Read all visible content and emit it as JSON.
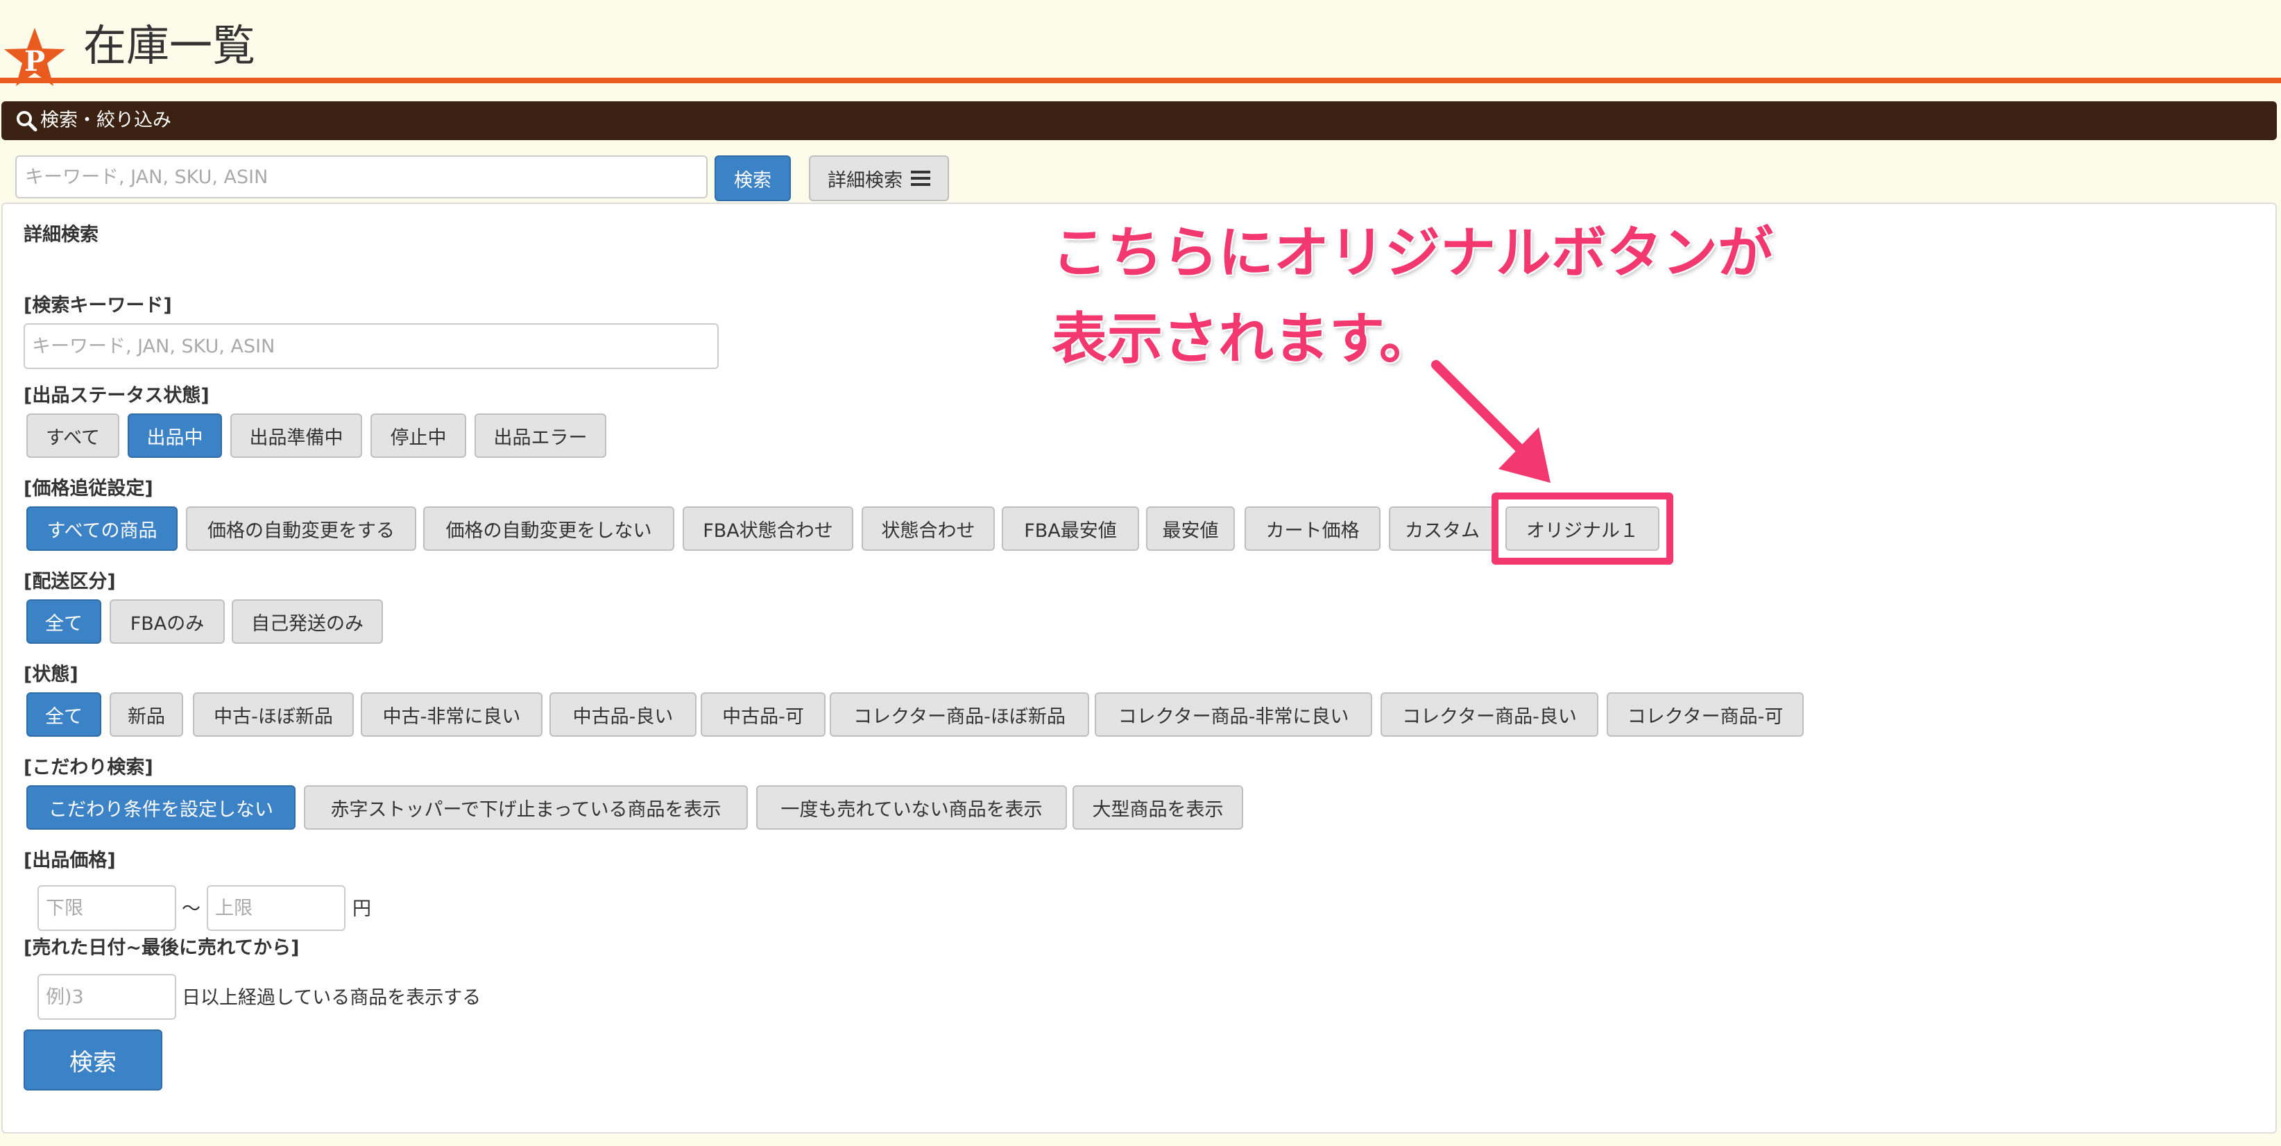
{
  "header": {
    "title": "在庫一覧",
    "logo_letter": "P"
  },
  "search_bar": {
    "label": "検索・絞り込み"
  },
  "quick_search": {
    "placeholder": "キーワード, JAN, SKU, ASIN",
    "search_label": "検索",
    "advanced_label": "詳細検索"
  },
  "panel": {
    "title": "詳細検索",
    "keyword": {
      "label": "[検索キーワード]",
      "placeholder": "キーワード, JAN, SKU, ASIN"
    },
    "listing_status": {
      "label": "[出品ステータス状態]",
      "options": [
        "すべて",
        "出品中",
        "出品準備中",
        "停止中",
        "出品エラー"
      ],
      "selected": "出品中"
    },
    "price_tracking": {
      "label": "[価格追従設定]",
      "options": [
        "すべての商品",
        "価格の自動変更をする",
        "価格の自動変更をしない",
        "FBA状態合わせ",
        "状態合わせ",
        "FBA最安値",
        "最安値",
        "カート価格",
        "カスタム",
        "オリジナル１"
      ],
      "selected": "すべての商品"
    },
    "shipping": {
      "label": "[配送区分]",
      "options": [
        "全て",
        "FBAのみ",
        "自己発送のみ"
      ],
      "selected": "全て"
    },
    "condition": {
      "label": "[状態]",
      "options": [
        "全て",
        "新品",
        "中古-ほぼ新品",
        "中古-非常に良い",
        "中古品-良い",
        "中古品-可",
        "コレクター商品-ほぼ新品",
        "コレクター商品-非常に良い",
        "コレクター商品-良い",
        "コレクター商品-可"
      ],
      "selected": "全て"
    },
    "special": {
      "label": "[こだわり検索]",
      "options": [
        "こだわり条件を設定しない",
        "赤字ストッパーで下げ止まっている商品を表示",
        "一度も売れていない商品を表示",
        "大型商品を表示"
      ],
      "selected": "こだわり条件を設定しない"
    },
    "price": {
      "label": "[出品価格]",
      "min_placeholder": "下限",
      "separator": "〜",
      "max_placeholder": "上限",
      "unit": "円"
    },
    "sold_date": {
      "label": "[売れた日付~最後に売れてから]",
      "placeholder": "例)3",
      "suffix": "日以上経過している商品を表示する"
    },
    "submit_label": "検索"
  },
  "annotation": {
    "line1": "こちらにオリジナルボタンが",
    "line2": "表示されます。"
  },
  "colors": {
    "primary": "#3b82c7",
    "header_line": "#e85a1e",
    "search_bar_bg": "#3b2111",
    "annotation": "#f2386e",
    "page_bg": "#fdfbe9"
  }
}
